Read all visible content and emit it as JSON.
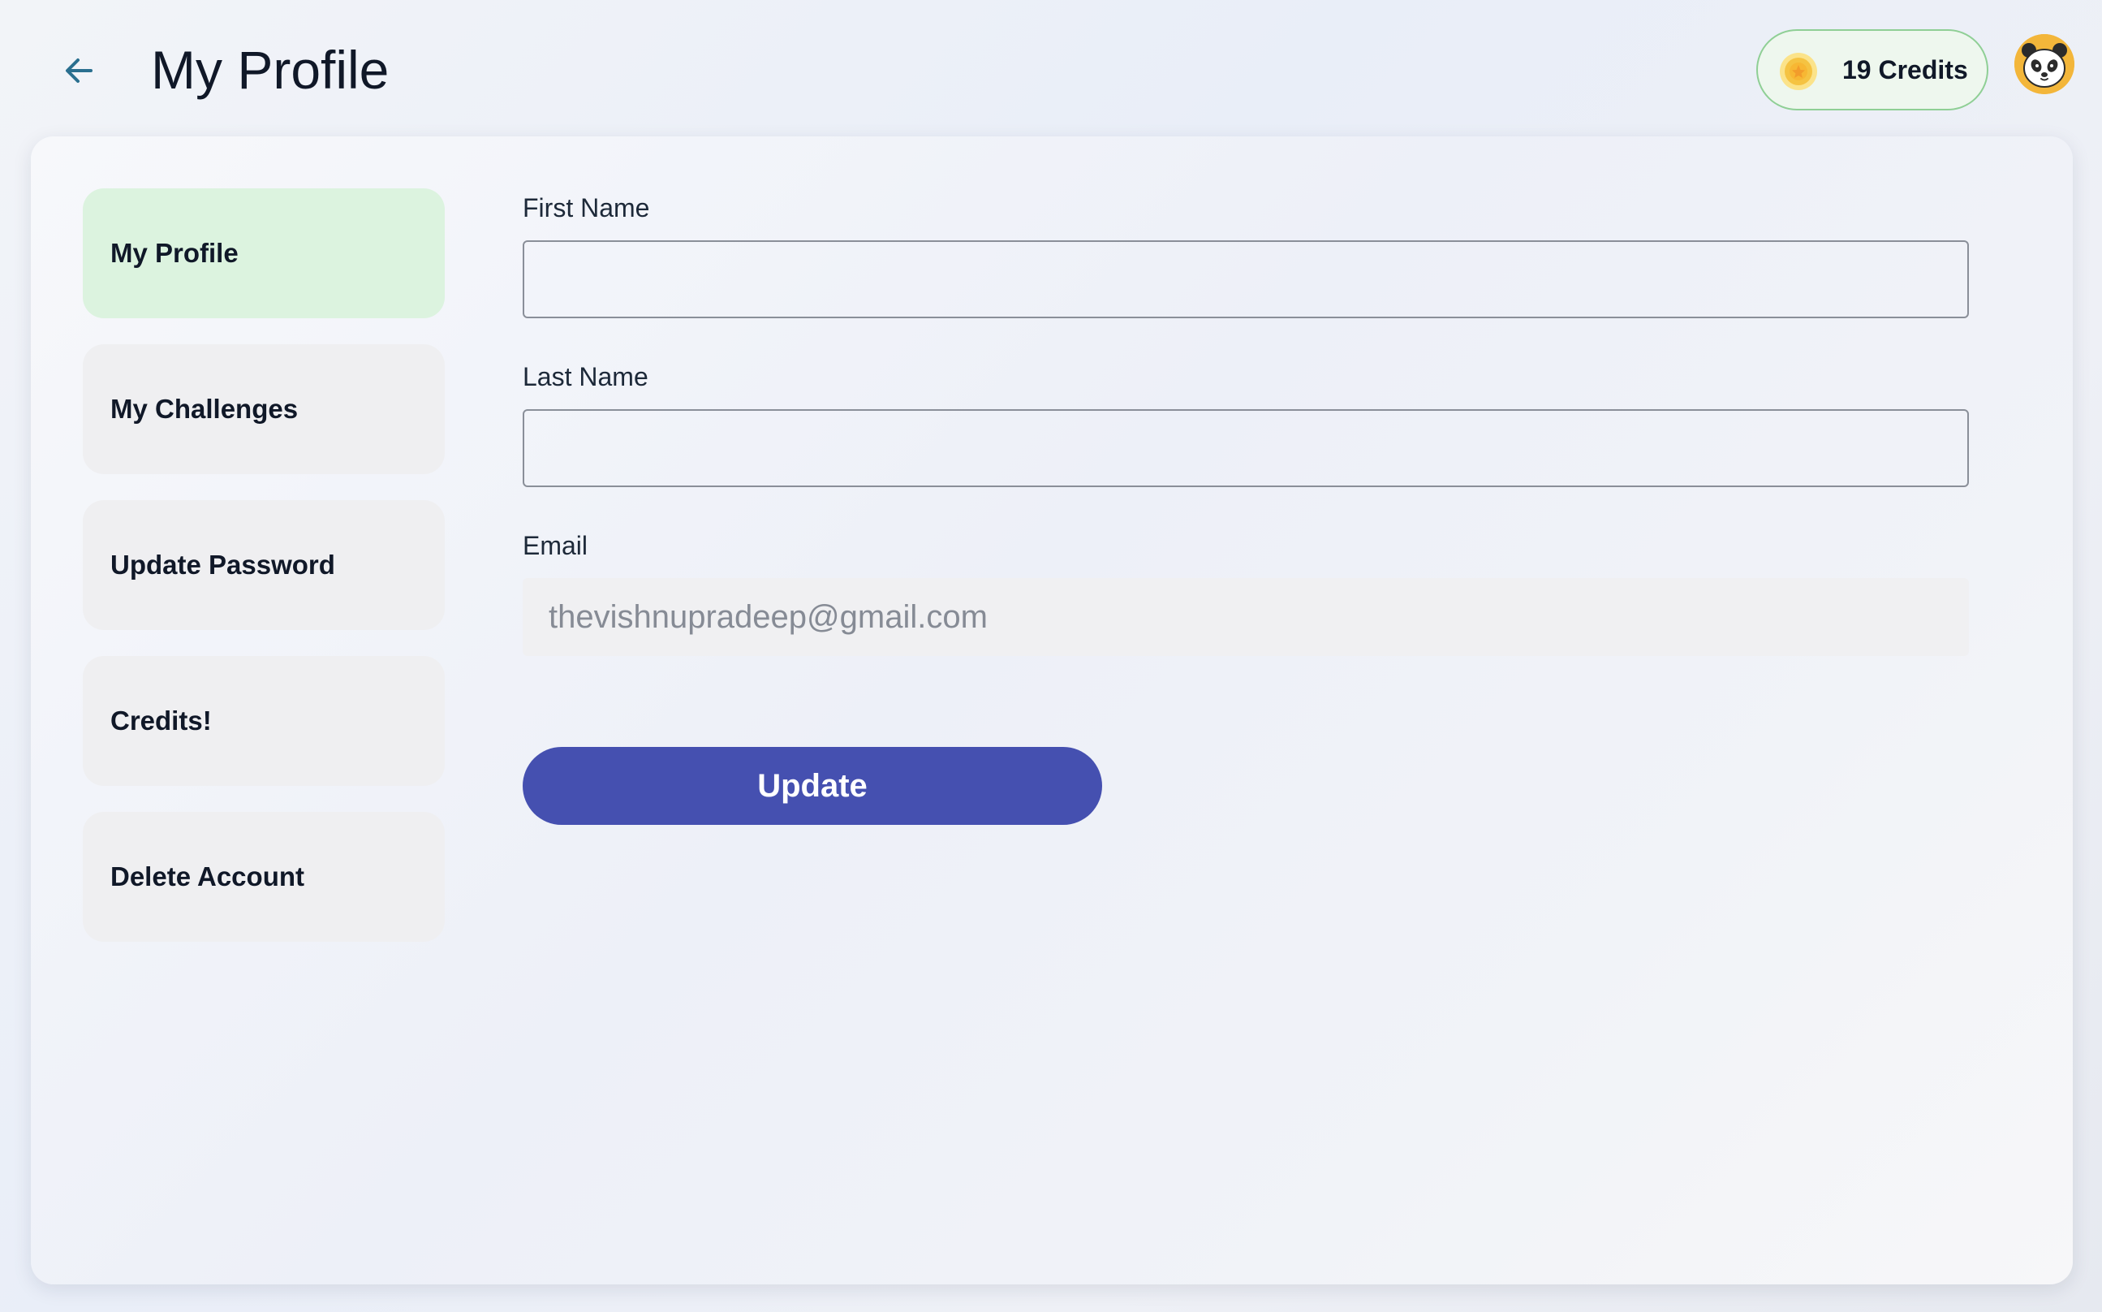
{
  "header": {
    "title": "My Profile",
    "credits_label": "19 Credits"
  },
  "sidebar": {
    "items": [
      {
        "label": "My Profile",
        "active": true
      },
      {
        "label": "My Challenges",
        "active": false
      },
      {
        "label": "Update Password",
        "active": false
      },
      {
        "label": "Credits!",
        "active": false
      },
      {
        "label": "Delete Account",
        "active": false
      }
    ]
  },
  "form": {
    "first_name_label": "First Name",
    "first_name_value": "",
    "last_name_label": "Last Name",
    "last_name_value": "",
    "email_label": "Email",
    "email_value": "thevishnupradeep@gmail.com",
    "update_label": "Update"
  },
  "colors": {
    "accent": "#4550b0",
    "active_nav": "#dcf3df",
    "credits_border": "#8fcf95",
    "coin": "#f5c342"
  },
  "icons": {
    "back": "arrow-left-icon",
    "coin": "coin-icon",
    "avatar": "panda-avatar"
  }
}
